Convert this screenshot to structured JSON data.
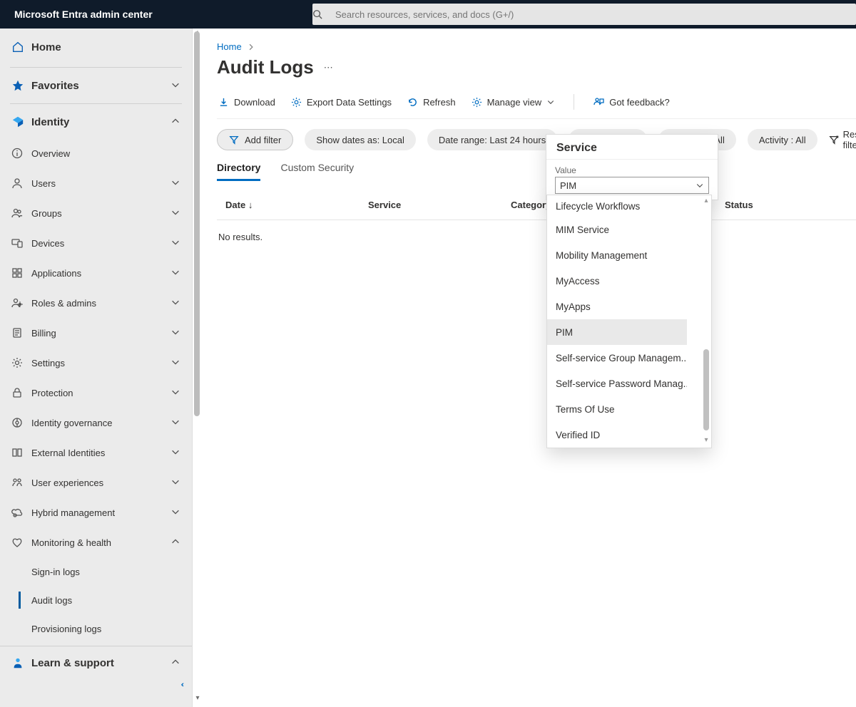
{
  "product_name": "Microsoft Entra admin center",
  "search_placeholder": "Search resources, services, and docs (G+/)",
  "sidebar": {
    "home": "Home",
    "favorites": "Favorites",
    "identity": "Identity",
    "items": [
      "Overview",
      "Users",
      "Groups",
      "Devices",
      "Applications",
      "Roles & admins",
      "Billing",
      "Settings",
      "Protection",
      "Identity governance",
      "External Identities",
      "User experiences",
      "Hybrid management",
      "Monitoring & health"
    ],
    "monitoring_sub": [
      "Sign-in logs",
      "Audit logs",
      "Provisioning logs"
    ],
    "learn": "Learn & support"
  },
  "breadcrumb": {
    "home": "Home"
  },
  "page_title": "Audit Logs",
  "toolbar": {
    "download": "Download",
    "export": "Export Data Settings",
    "refresh": "Refresh",
    "manage_view": "Manage view",
    "feedback": "Got feedback?"
  },
  "filters": {
    "add": "Add filter",
    "dates": "Show dates as: Local",
    "range": "Date range: Last 24 hours",
    "service": "Service : PIM",
    "category": "Category : All",
    "activity": "Activity : All",
    "reset": "Reset filters"
  },
  "tabs": {
    "directory": "Directory",
    "custom": "Custom Security"
  },
  "table": {
    "col_date": "Date",
    "col_service": "Service",
    "col_category": "Category",
    "col_status": "Status",
    "no_results": "No results."
  },
  "popup": {
    "title": "Service",
    "value_label": "Value",
    "selected": "PIM"
  },
  "dropdown": {
    "options": [
      "Lifecycle Workflows",
      "MIM Service",
      "Mobility Management",
      "MyAccess",
      "MyApps",
      "PIM",
      "Self-service Group Managem...",
      "Self-service Password Manag...",
      "Terms Of Use",
      "Verified ID"
    ],
    "selected_index": 5
  }
}
